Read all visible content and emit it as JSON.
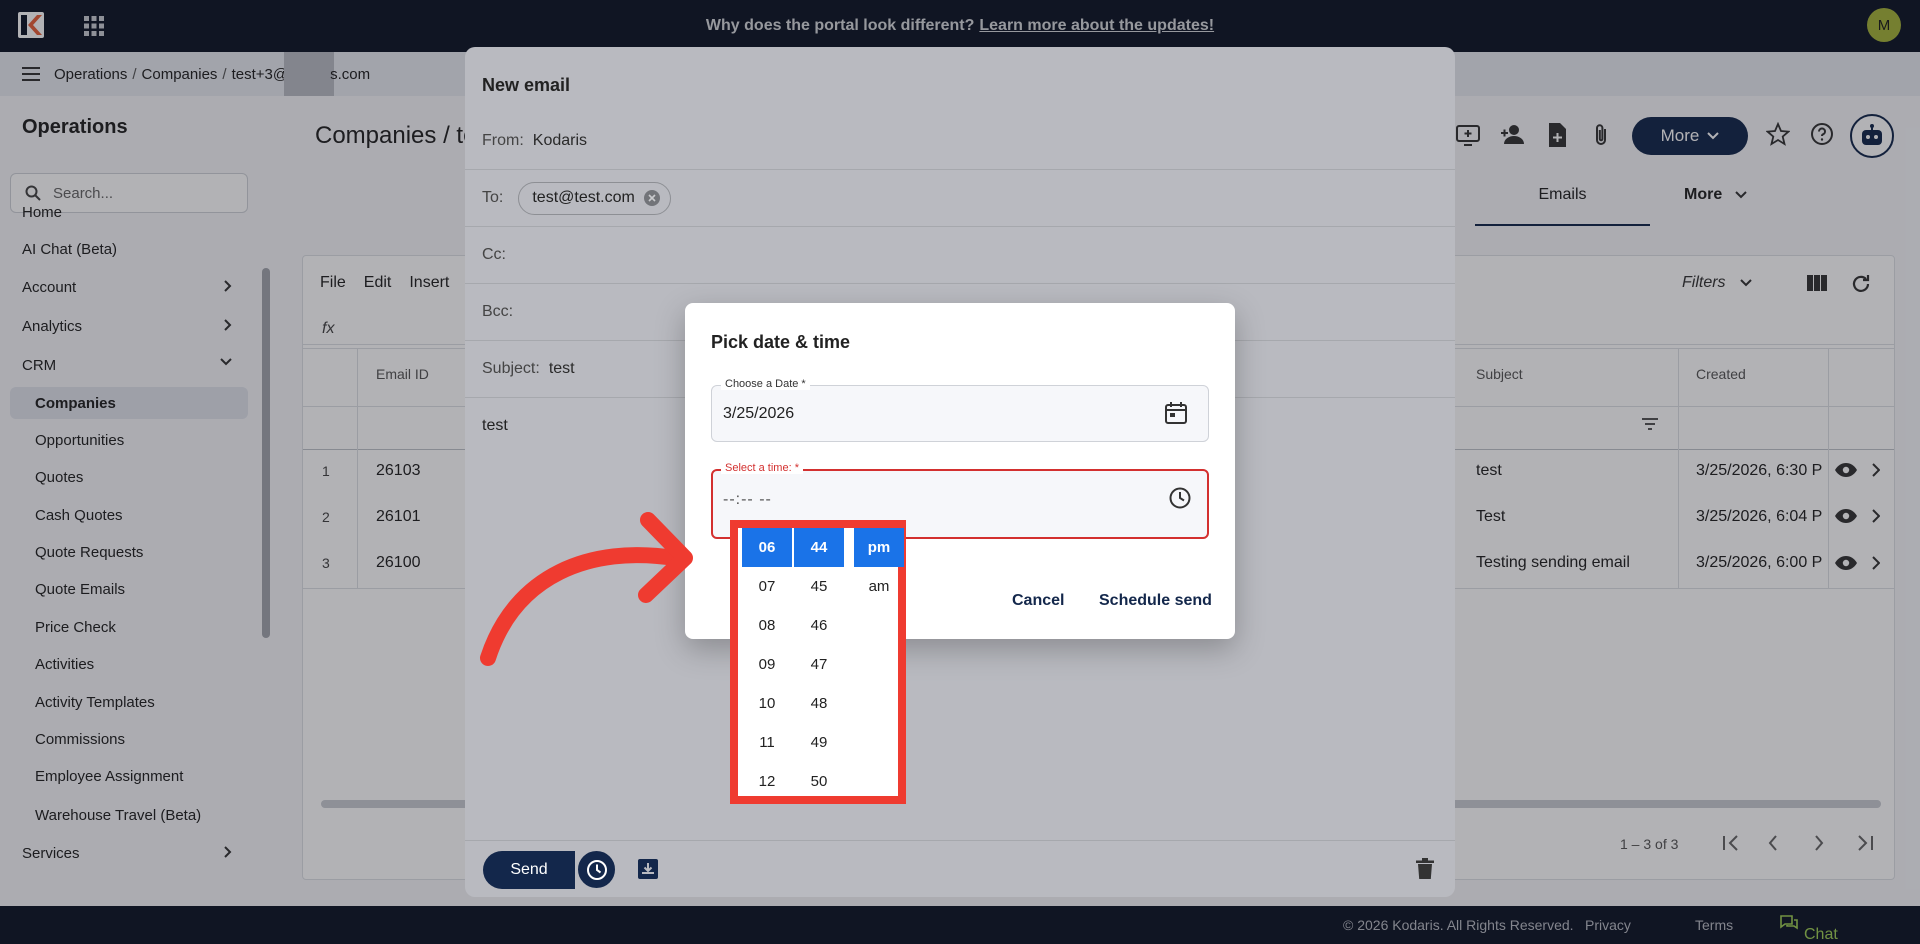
{
  "topbar": {
    "banner_text": "Why does the portal look different?",
    "banner_link": "Learn more about the updates!",
    "avatar_initial": "M"
  },
  "breadcrumb": {
    "items": [
      "Operations",
      "Companies",
      "test+3@",
      "s.com"
    ]
  },
  "sidebar": {
    "title": "Operations",
    "search_placeholder": "Search...",
    "items": [
      {
        "label": "Home",
        "level": "top"
      },
      {
        "label": "AI Chat (Beta)",
        "level": "top"
      },
      {
        "label": "Account",
        "level": "top",
        "chevron": "right"
      },
      {
        "label": "Analytics",
        "level": "top",
        "chevron": "right"
      },
      {
        "label": "CRM",
        "level": "top",
        "chevron": "down"
      },
      {
        "label": "Companies",
        "level": "sub",
        "active": true
      },
      {
        "label": "Opportunities",
        "level": "sub"
      },
      {
        "label": "Quotes",
        "level": "sub"
      },
      {
        "label": "Cash Quotes",
        "level": "sub"
      },
      {
        "label": "Quote Requests",
        "level": "sub"
      },
      {
        "label": "Quote Emails",
        "level": "sub"
      },
      {
        "label": "Price Check",
        "level": "sub"
      },
      {
        "label": "Activities",
        "level": "sub"
      },
      {
        "label": "Activity Templates",
        "level": "sub"
      },
      {
        "label": "Commissions",
        "level": "sub"
      },
      {
        "label": "Employee Assignment",
        "level": "sub"
      },
      {
        "label": "Warehouse Travel (Beta)",
        "level": "sub"
      },
      {
        "label": "Services",
        "level": "top",
        "chevron": "right"
      }
    ]
  },
  "page": {
    "title": "Companies / te",
    "more_label": "More",
    "tabs": {
      "emails": "Emails",
      "more": "More"
    }
  },
  "grid": {
    "menu": [
      "File",
      "Edit",
      "Insert"
    ],
    "fx": "fx",
    "filters_label": "Filters",
    "headers": {
      "email_id": "Email ID",
      "subject": "Subject",
      "created": "Created"
    },
    "rows": [
      {
        "num": "1",
        "email_id": "26103",
        "subject": "test",
        "created": "3/25/2026, 6:30 P"
      },
      {
        "num": "2",
        "email_id": "26101",
        "subject": "Test",
        "created": "3/25/2026, 6:04 P"
      },
      {
        "num": "3",
        "email_id": "26100",
        "subject": "Testing sending email",
        "created": "3/25/2026, 6:00 P"
      }
    ],
    "pager": "1 – 3 of 3"
  },
  "footer": {
    "copyright": "© 2026 Kodaris. All Rights Reserved.",
    "privacy": "Privacy",
    "terms": "Terms",
    "chat": "Chat with us"
  },
  "email": {
    "title": "New email",
    "from_label": "From:",
    "from_value": "Kodaris",
    "to_label": "To:",
    "to_chip": "test@test.com",
    "cc_label": "Cc:",
    "bcc_label": "Bcc:",
    "subject_label": "Subject:",
    "subject_value": "test",
    "body": "test",
    "send_label": "Send"
  },
  "picker": {
    "title": "Pick date & time",
    "date_label": "Choose a Date *",
    "date_value": "3/25/2026",
    "time_label": "Select a time: *",
    "time_value": "--:-- --",
    "cancel": "Cancel",
    "schedule": "Schedule send",
    "hours": [
      "06",
      "07",
      "08",
      "09",
      "10",
      "11",
      "12"
    ],
    "minutes": [
      "44",
      "45",
      "46",
      "47",
      "48",
      "49",
      "50"
    ],
    "ampm": [
      "pm",
      "am"
    ],
    "selected": {
      "hour": "06",
      "minute": "44",
      "ampm": "pm"
    }
  },
  "colors": {
    "navy": "#13274b",
    "highlight_red": "#ef3b30",
    "select_blue": "#1a73e8",
    "error_red": "#d3302f",
    "chat_green": "#9fcf55"
  }
}
